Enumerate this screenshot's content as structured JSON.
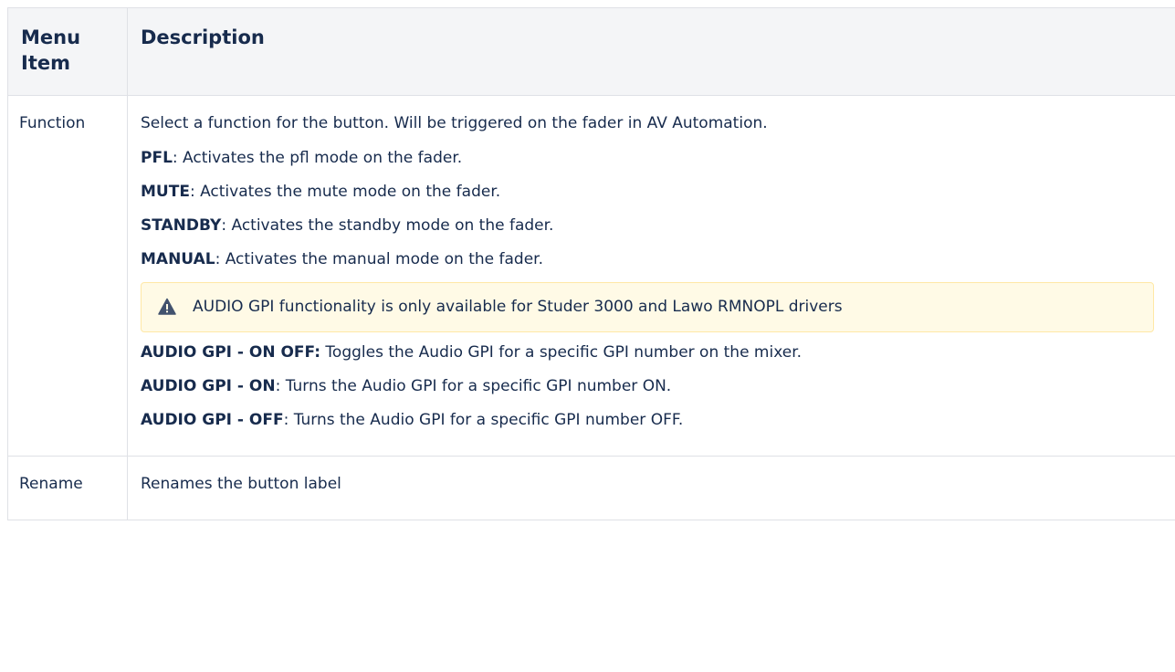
{
  "table": {
    "headers": [
      "Menu\nItem",
      "Description"
    ],
    "header_item_line1": "Menu",
    "header_item_line2": "Item",
    "header_desc": "Description"
  },
  "rows": {
    "function": {
      "item": "Function",
      "intro": "Select a function for the button. Will be triggered on the fader in AV Automation.",
      "options_before_note": [
        {
          "term": "PFL",
          "text": ": Activates the pfl mode on the fader."
        },
        {
          "term": "MUTE",
          "text": ": Activates the mute mode on the fader."
        },
        {
          "term": "STANDBY",
          "text": ": Activates the standby mode on the fader."
        },
        {
          "term": "MANUAL",
          "text": ": Activates the manual mode on the fader."
        }
      ],
      "note": {
        "icon": "warning-icon",
        "text": "AUDIO GPI functionality is only available for Studer 3000 and Lawo RMNOPL drivers"
      },
      "options_after_note": [
        {
          "term": "AUDIO GPI - ON OFF:",
          "text": " Toggles the Audio GPI for a specific GPI number on the mixer."
        },
        {
          "term": "AUDIO GPI - ON",
          "text": ": Turns the Audio GPI for a specific GPI number ON."
        },
        {
          "term": "AUDIO GPI - OFF",
          "text": ": Turns the Audio GPI for a specific GPI number OFF."
        }
      ]
    },
    "rename": {
      "item": "Rename",
      "text": "Renames the button label"
    }
  },
  "colors": {
    "header_bg": "#f4f5f7",
    "border": "#dfe1e6",
    "note_bg": "#fffae6",
    "note_border": "#ffe8a6",
    "text": "#172b4d"
  }
}
